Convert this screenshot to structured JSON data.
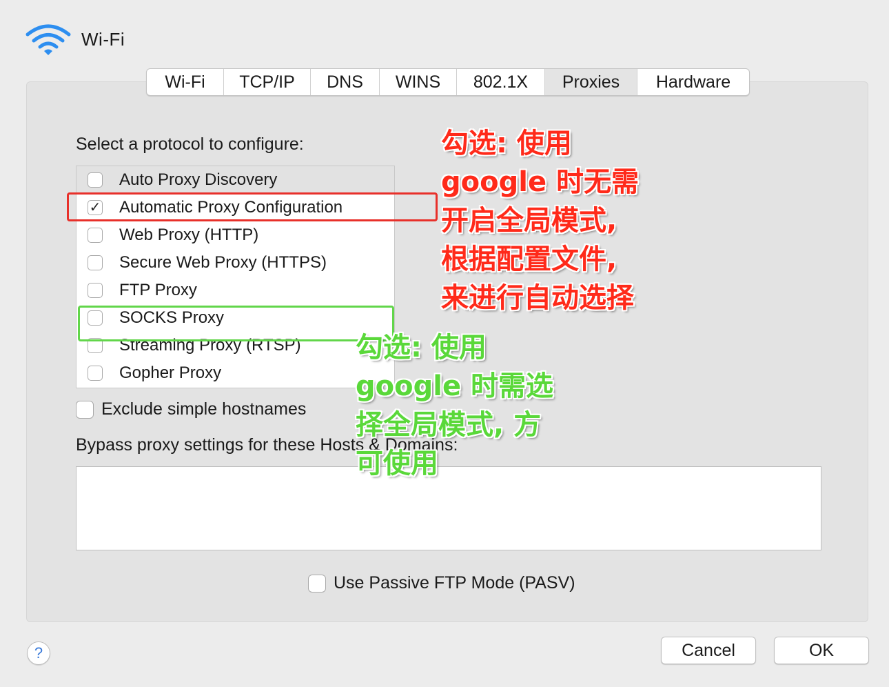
{
  "header": {
    "title": "Wi-Fi",
    "icon": "wifi-icon"
  },
  "tabs": [
    {
      "label": "Wi-Fi",
      "selected": false
    },
    {
      "label": "TCP/IP",
      "selected": false
    },
    {
      "label": "DNS",
      "selected": false
    },
    {
      "label": "WINS",
      "selected": false
    },
    {
      "label": "802.1X",
      "selected": false
    },
    {
      "label": "Proxies",
      "selected": true
    },
    {
      "label": "Hardware",
      "selected": false
    }
  ],
  "protocol_section": {
    "label": "Select a protocol to configure:",
    "items": [
      {
        "label": "Auto Proxy Discovery",
        "checked": false,
        "highlighted": true
      },
      {
        "label": "Automatic Proxy Configuration",
        "checked": true,
        "highlighted": false
      },
      {
        "label": "Web Proxy (HTTP)",
        "checked": false,
        "highlighted": false
      },
      {
        "label": "Secure Web Proxy (HTTPS)",
        "checked": false,
        "highlighted": false
      },
      {
        "label": "FTP Proxy",
        "checked": false,
        "highlighted": false
      },
      {
        "label": "SOCKS Proxy",
        "checked": false,
        "highlighted": false
      },
      {
        "label": "Streaming Proxy (RTSP)",
        "checked": false,
        "highlighted": false
      },
      {
        "label": "Gopher Proxy",
        "checked": false,
        "highlighted": false
      }
    ]
  },
  "exclude_simple_hostnames": {
    "label": "Exclude simple hostnames",
    "checked": false
  },
  "bypass": {
    "label": "Bypass proxy settings for these Hosts & Domains:",
    "value": ""
  },
  "passive_ftp": {
    "label": "Use Passive FTP Mode (PASV)",
    "checked": false
  },
  "buttons": {
    "help": "?",
    "cancel": "Cancel",
    "ok": "OK"
  },
  "checkmark": "✓",
  "annotations": {
    "red": {
      "text": "勾选: 使用\ngoogle 时无需\n开启全局模式,\n根据配置文件,\n来进行自动选择",
      "color": "#ff2a1a",
      "box_color": "#e8302a"
    },
    "green": {
      "text": "勾选: 使用\ngoogle 时需选\n择全局模式, 方\n可使用",
      "color": "#5ad83a",
      "box_color": "#62d64a"
    }
  }
}
